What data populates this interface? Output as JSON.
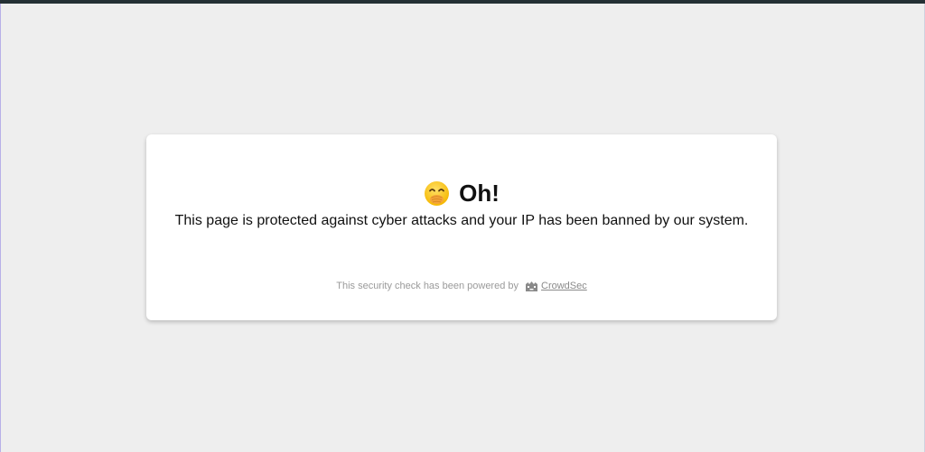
{
  "header": {
    "emoji_icon": "hand-over-mouth-emoji-icon",
    "title": "Oh!"
  },
  "body": {
    "message": "This page is protected against cyber attacks and your IP has been banned by our system."
  },
  "footer": {
    "powered_by_text": "This security check has been powered by",
    "logo_icon": "crowdsec-logo-icon",
    "link_text": "CrowdSec"
  },
  "colors": {
    "background": "#eeeeee",
    "card": "#ffffff",
    "top_bar": "#243034",
    "text": "#111111",
    "muted_text": "#9a9a9a"
  }
}
